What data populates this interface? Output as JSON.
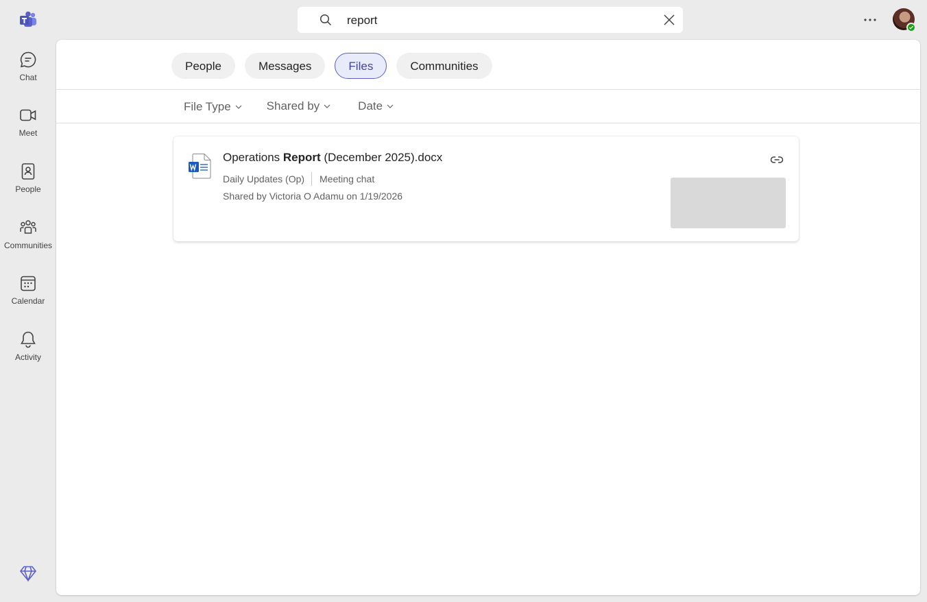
{
  "search": {
    "value": "report"
  },
  "rail": {
    "items": [
      {
        "label": "Chat",
        "icon": "chat-icon"
      },
      {
        "label": "Meet",
        "icon": "video-icon"
      },
      {
        "label": "People",
        "icon": "contact-book-icon"
      },
      {
        "label": "Communities",
        "icon": "communities-icon"
      },
      {
        "label": "Calendar",
        "icon": "calendar-icon"
      },
      {
        "label": "Activity",
        "icon": "bell-icon"
      }
    ]
  },
  "tabs": [
    {
      "label": "People",
      "active": false
    },
    {
      "label": "Messages",
      "active": false
    },
    {
      "label": "Files",
      "active": true
    },
    {
      "label": "Communities",
      "active": false
    }
  ],
  "filters": [
    {
      "label": "File Type"
    },
    {
      "label": "Shared by"
    },
    {
      "label": "Date"
    }
  ],
  "results": [
    {
      "name_prefix": "Operations ",
      "name_match": "Report",
      "name_suffix": " (December 2025).docx",
      "location": "Daily Updates (Op)",
      "source": "Meeting chat",
      "shared": "Shared by Victoria O Adamu on 1/19/2026"
    }
  ],
  "colors": {
    "brand": "#5b5fc7",
    "active_tab_bg": "#e8ebfa",
    "presence": "#13a10e",
    "word": "#185abd"
  }
}
